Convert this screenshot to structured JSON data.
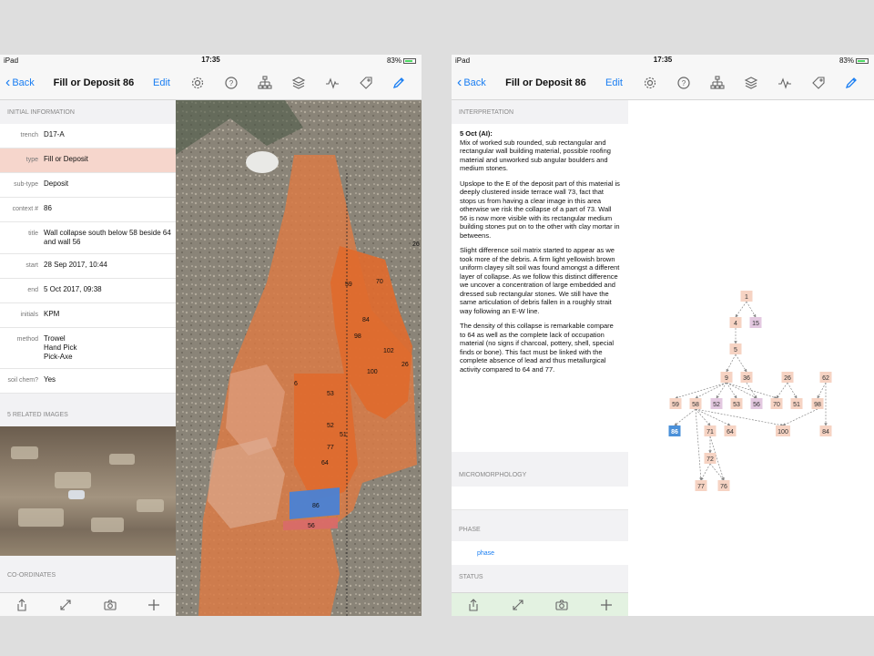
{
  "status_bar": {
    "device": "iPad",
    "time": "17:35",
    "battery": "83%"
  },
  "nav": {
    "back_label": "Back",
    "title": "Fill or Deposit 86",
    "edit_label": "Edit"
  },
  "toolbar": {
    "icons": [
      "gear-icon",
      "help-icon",
      "hierarchy-icon",
      "layers-icon",
      "graph-icon",
      "tag-icon",
      "pencil-icon"
    ]
  },
  "initial_info": {
    "header": "INITIAL INFORMATION",
    "fields": [
      {
        "label": "trench",
        "value": "D17-A"
      },
      {
        "label": "type",
        "value": "Fill or Deposit"
      },
      {
        "label": "sub-type",
        "value": "Deposit"
      },
      {
        "label": "context #",
        "value": "86"
      },
      {
        "label": "title",
        "value": "Wall collapse south below 58 beside 64 and wall 56"
      },
      {
        "label": "start",
        "value": "28 Sep 2017, 10:44"
      },
      {
        "label": "end",
        "value": "5 Oct 2017, 09:38"
      },
      {
        "label": "initials",
        "value": "KPM"
      },
      {
        "label": "method",
        "value": "Trowel\nHand Pick\nPick-Axe"
      },
      {
        "label": "soil chem?",
        "value": "Yes"
      }
    ]
  },
  "related_images": {
    "header": "5 RELATED IMAGES"
  },
  "coordinates": {
    "header": "CO-ORDINATES"
  },
  "bottom_bar": {
    "icons": [
      "share-icon",
      "expand-icon",
      "camera-icon",
      "plus-icon"
    ]
  },
  "map": {
    "labels": [
      "59",
      "70",
      "84",
      "98",
      "102",
      "26",
      "100",
      "6",
      "53",
      "52",
      "51",
      "77",
      "64",
      "86",
      "56",
      "26"
    ],
    "colors": {
      "orange": "#e0733a",
      "blue": "#4a82d4",
      "pink": "#d96a6a"
    }
  },
  "interpretation": {
    "header": "INTERPRETATION",
    "date": "5 Oct (AI):",
    "paragraphs": [
      "Mix of worked sub rounded, sub rectangular and rectangular wall building material, possible roofing material and unworked sub angular boulders and medium stones.",
      "Upslope to the E of the deposit part of this material is deeply clustered inside terrace wall 73, fact that stops us from having a clear image in this area otherwise we risk the collapse of a part of 73. Wall 56 is now more visible with its rectangular medium building stones put on to the other with clay mortar in betweens.",
      "Slight difference soil matrix started to appear as we took more of the debris. A firm light yellowish brown uniform clayey silt soil was found amongst a different layer of collapse. As we follow this distinct difference we uncover a concentration of large embedded and dressed sub rectangular stones. We still have the same articulation of debris fallen in a  roughly strait way following an E-W line.",
      "The density of this collapse is remarkable compare to 64 as well as the complete lack of occupation material (no signs if charcoal, pottery, shell, special finds or bone). This fact must be linked with the complete absence of lead and thus metallurgical activity compared to 64 and 77."
    ]
  },
  "micromorphology": {
    "header": "MICROMORPHOLOGY"
  },
  "phase": {
    "header": "PHASE",
    "value": "phase"
  },
  "status": {
    "header": "STATUS"
  },
  "graph": {
    "nodes": [
      "1",
      "4",
      "15",
      "5",
      "9",
      "36",
      "26",
      "62",
      "59",
      "58",
      "52",
      "53",
      "56",
      "70",
      "51",
      "98",
      "86",
      "71",
      "64",
      "100",
      "84",
      "72",
      "77",
      "76"
    ],
    "colors": {
      "node": "#f6d3c3",
      "purple": "#e3c8e0",
      "selected": "#4a90d9"
    }
  }
}
